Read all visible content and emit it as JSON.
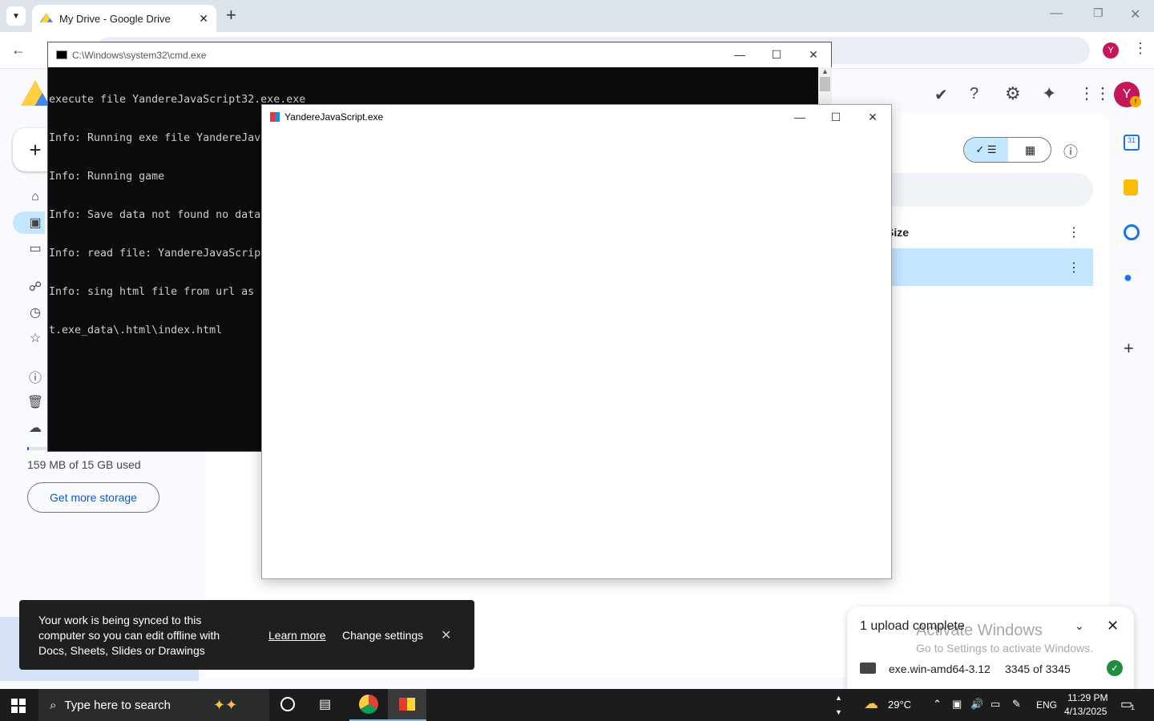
{
  "browser": {
    "tab_title": "My Drive - Google Drive",
    "new_tab": "+",
    "menu": "⋮",
    "account_initial": "Y"
  },
  "drive": {
    "account_initial": "Y",
    "new_label": "+",
    "storage_used": "159 MB of 15 GB used",
    "storage_fraction": 0.01,
    "get_storage": "Get more storage",
    "size_column": "Size"
  },
  "cmd": {
    "title": "C:\\Windows\\system32\\cmd.exe",
    "lines": [
      "execute file YandereJavaScript32.exe.exe",
      "Info: Running exe file YandereJavaScript32.exe.exe",
      "Info: Running game",
      "Info: Save data not found no data",
      "Info: read file: YandereJavaScript",
      "Info: sing html file from url as",
      "t.exe_data\\.html\\index.html"
    ]
  },
  "app": {
    "title": "YandereJavaScript.exe"
  },
  "toast": {
    "message": "Your work is being synced to this computer so you can edit offline with Docs, Sheets, Slides or Drawings",
    "learn_more": "Learn more",
    "change_settings": "Change settings"
  },
  "upload": {
    "title": "1 upload complete",
    "file_name": "exe.win-amd64-3.12",
    "progress": "3345 of 3345"
  },
  "watermark": {
    "line1": "Activate Windows",
    "line2": "Go to Settings to activate Windows."
  },
  "taskbar": {
    "search_placeholder": "Type here to search",
    "weather": "29°C",
    "lang": "ENG",
    "time": "11:29 PM",
    "date": "4/13/2025",
    "notif_count": "1"
  }
}
